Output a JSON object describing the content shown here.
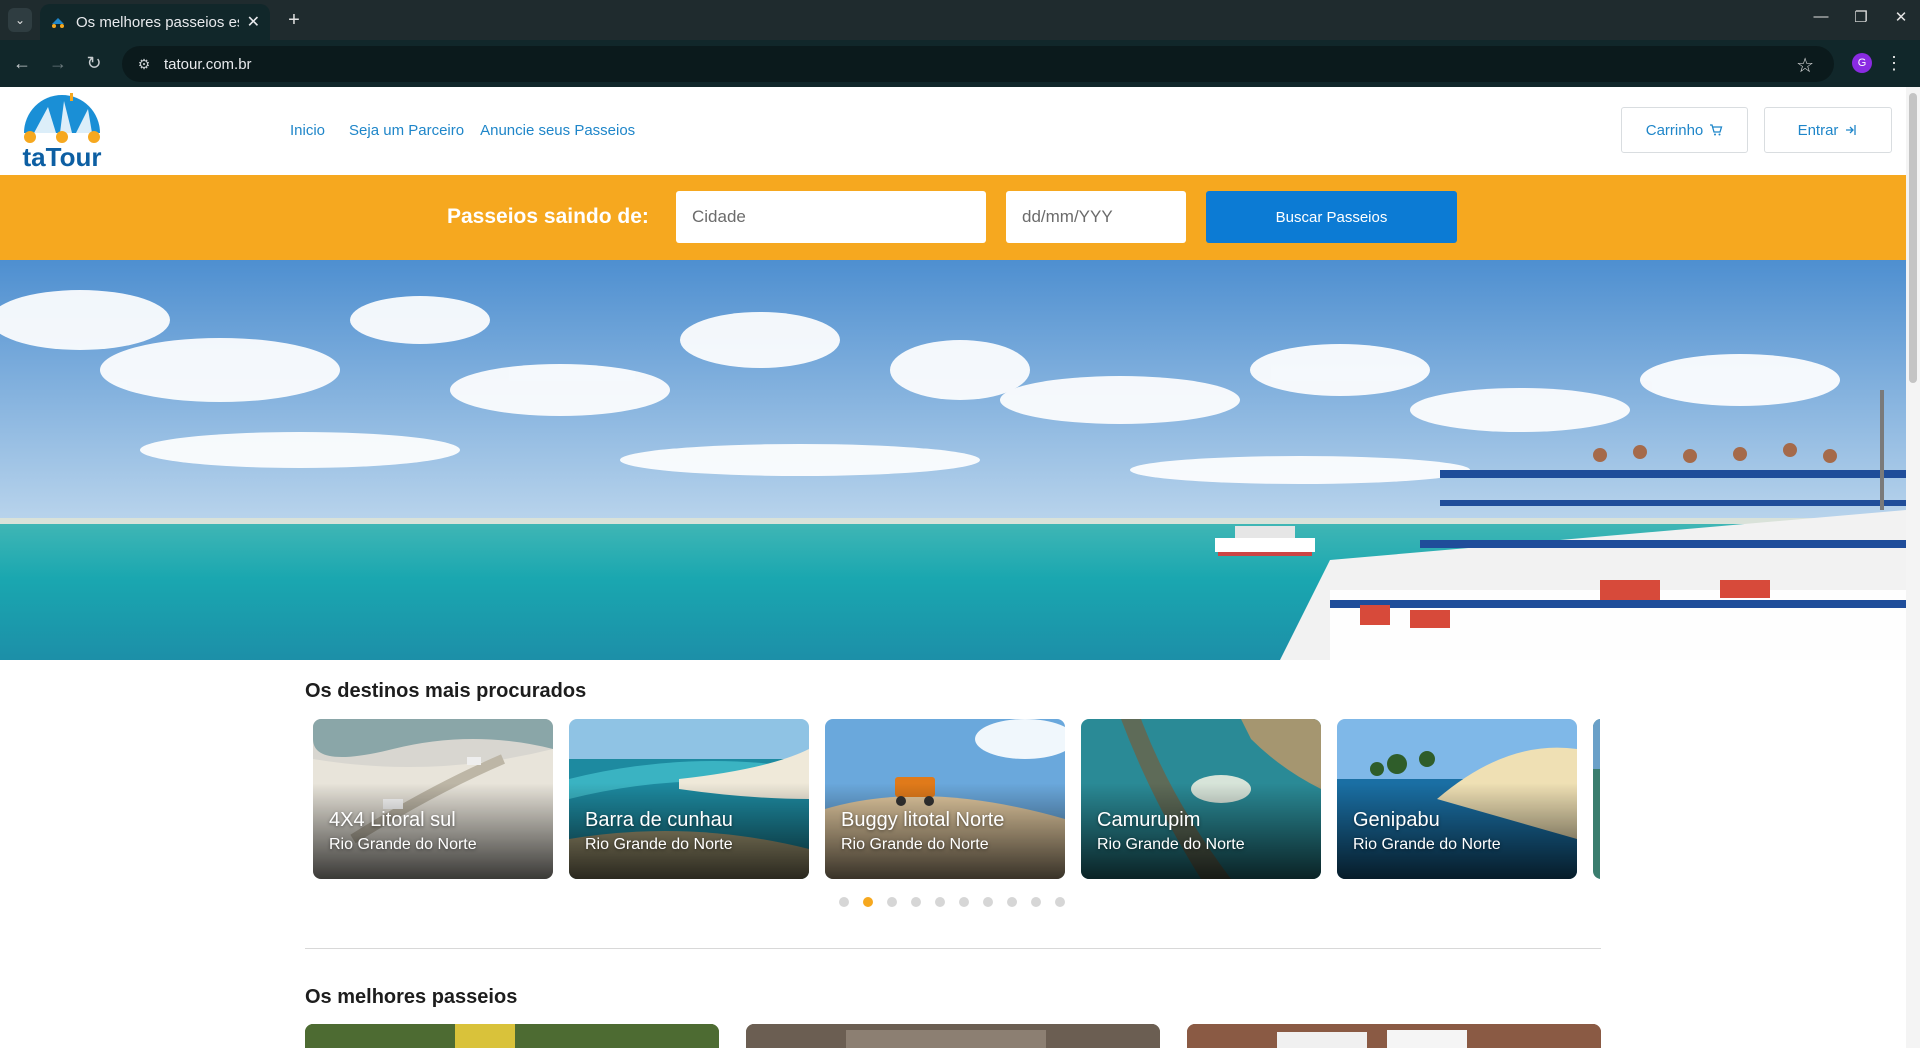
{
  "browser": {
    "tab_title": "Os melhores passeios estão aqui",
    "url": "tatour.com.br",
    "profile_initial": "G"
  },
  "site": {
    "logo_text": "taTour",
    "nav": [
      "Inicio",
      "Seja um Parceiro",
      "Anuncie seus Passeios"
    ],
    "cart_label": "Carrinho",
    "login_label": "Entrar"
  },
  "search": {
    "label": "Passeios saindo de:",
    "city_placeholder": "Cidade",
    "date_placeholder": "dd/mm/YYY",
    "button_label": "Buscar Passeios"
  },
  "destinations": {
    "title": "Os destinos mais procurados",
    "items": [
      {
        "name": "4X4 Litoral sul",
        "region": "Rio Grande do Norte"
      },
      {
        "name": "Barra de cunhau",
        "region": "Rio Grande do Norte"
      },
      {
        "name": "Buggy litotal Norte",
        "region": "Rio Grande do Norte"
      },
      {
        "name": "Camurupim",
        "region": "Rio Grande do Norte"
      },
      {
        "name": "Genipabu",
        "region": "Rio Grande do Norte"
      }
    ],
    "pagination": {
      "total": 10,
      "active": 2
    }
  },
  "tours": {
    "title": "Os melhores passeios"
  },
  "colors": {
    "brand_orange": "#f6a81f",
    "brand_blue": "#1f86c9",
    "button_blue": "#0c7bd4"
  }
}
